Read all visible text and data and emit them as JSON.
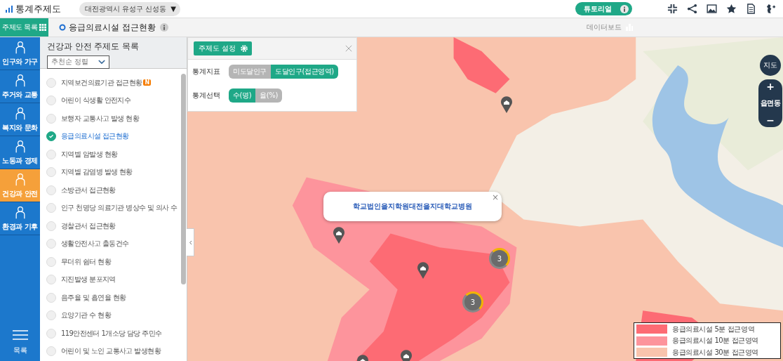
{
  "header": {
    "logo": "통계주제도",
    "region": "대전광역시 유성구 신성동",
    "region_caret": "▼",
    "tutorial": "튜토리얼"
  },
  "subbar": {
    "list_button": "주제도 목록",
    "title": "응급의료시설 접근현황",
    "dashboard": "데이터보드"
  },
  "categories": [
    {
      "label": "인구와 가구",
      "selected": false
    },
    {
      "label": "주거와 교통",
      "selected": false
    },
    {
      "label": "복지와 문화",
      "selected": false
    },
    {
      "label": "노동과 경제",
      "selected": false
    },
    {
      "label": "건강과 안전",
      "selected": true
    },
    {
      "label": "환경과 기후",
      "selected": false
    }
  ],
  "menu_label": "목록",
  "sidebar": {
    "title": "건강과 안전 주제도 목록",
    "sort": "추천순 정렬",
    "items": [
      {
        "label": "지역보건의료기관 접근현황",
        "selected": false,
        "badge": "N"
      },
      {
        "label": "어린이 식생활 안전지수",
        "selected": false
      },
      {
        "label": "보행자 교통사고 발생 현황",
        "selected": false
      },
      {
        "label": "응급의료시설 접근현황",
        "selected": true
      },
      {
        "label": "지역별 암발생 현황",
        "selected": false
      },
      {
        "label": "지역별 감염병 발생 현황",
        "selected": false
      },
      {
        "label": "소방관서 접근현황",
        "selected": false
      },
      {
        "label": "인구 천명당 의료기관 병상수 및 의사 수",
        "selected": false
      },
      {
        "label": "경찰관서 접근현황",
        "selected": false
      },
      {
        "label": "생활안전사고 출동건수",
        "selected": false
      },
      {
        "label": "무더위 쉼터 현황",
        "selected": false
      },
      {
        "label": "지진발생 분포지역",
        "selected": false
      },
      {
        "label": "음주율 및 흡연율 현황",
        "selected": false
      },
      {
        "label": "요양기관 수 현황",
        "selected": false
      },
      {
        "label": "119안전센터 1개소당 담당 주민수",
        "selected": false
      },
      {
        "label": "어린이 및 노인 교통사고 발생현황",
        "selected": false
      }
    ]
  },
  "settings": {
    "button": "주제도 설정",
    "rows": [
      {
        "label": "통계지표",
        "options": [
          {
            "label": "미도달인구",
            "selected": false
          },
          {
            "label": "도달인구(접근영역)",
            "selected": true
          }
        ]
      },
      {
        "label": "통계선택",
        "options": [
          {
            "label": "수(명)",
            "selected": true
          },
          {
            "label": "율(%)",
            "selected": false
          }
        ]
      }
    ]
  },
  "map": {
    "popup": "학교법인을지학원대전을지대학교병원",
    "popup_close": "×",
    "clusters": [
      {
        "count": "3"
      },
      {
        "count": "3"
      }
    ],
    "map_button": "지도",
    "zoom_in": "+",
    "zoom_level": "읍면동",
    "zoom_out": "−",
    "legend": [
      {
        "label": "응급의료시설 5분 접근영역",
        "color": "#fd6b74"
      },
      {
        "label": "응급의료시설 10분 접근영역",
        "color": "#fd949c"
      },
      {
        "label": "응급의료시설 30분 접근영역",
        "color": "#f9c4ad"
      }
    ]
  }
}
